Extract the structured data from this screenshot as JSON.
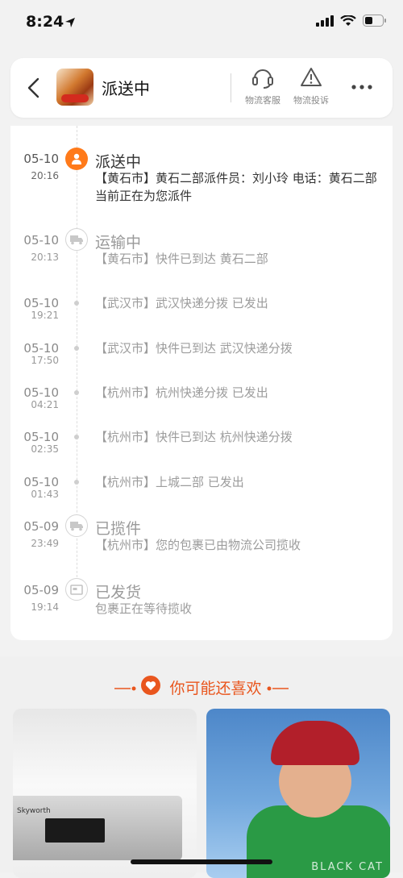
{
  "status_bar": {
    "time": "8:24"
  },
  "header": {
    "title": "派送中",
    "service_label": "物流客服",
    "complaint_label": "物流投诉"
  },
  "timeline": [
    {
      "date": "05-10",
      "time": "20:16",
      "status": "派送中",
      "desc": "【黄石市】黄石二部派件员：刘小玲 电话：黄石二部 当前正在为您派件"
    },
    {
      "date": "05-10",
      "time": "20:13",
      "status": "运输中",
      "desc": "【黄石市】快件已到达 黄石二部"
    },
    {
      "date": "05-10",
      "time": "19:21",
      "status": "",
      "desc": "【武汉市】武汉快递分拨 已发出"
    },
    {
      "date": "05-10",
      "time": "17:50",
      "status": "",
      "desc": "【武汉市】快件已到达 武汉快递分拨"
    },
    {
      "date": "05-10",
      "time": "04:21",
      "status": "",
      "desc": "【杭州市】杭州快递分拨 已发出"
    },
    {
      "date": "05-10",
      "time": "02:35",
      "status": "",
      "desc": "【杭州市】快件已到达 杭州快递分拨"
    },
    {
      "date": "05-10",
      "time": "01:43",
      "status": "",
      "desc": "【杭州市】上城二部 已发出"
    },
    {
      "date": "05-09",
      "time": "23:49",
      "status": "已揽件",
      "desc": "【杭州市】您的包裹已由物流公司揽收"
    },
    {
      "date": "05-09",
      "time": "19:14",
      "status": "已发货",
      "desc": "包裹正在等待揽收"
    }
  ],
  "recommend": {
    "title": "你可能还喜欢"
  },
  "products": [
    {
      "brand": "Skyworth"
    },
    {
      "watermark": "BLACK CAT"
    }
  ],
  "colors": {
    "accent": "#ff7a1a",
    "recommend": "#e9561e"
  }
}
